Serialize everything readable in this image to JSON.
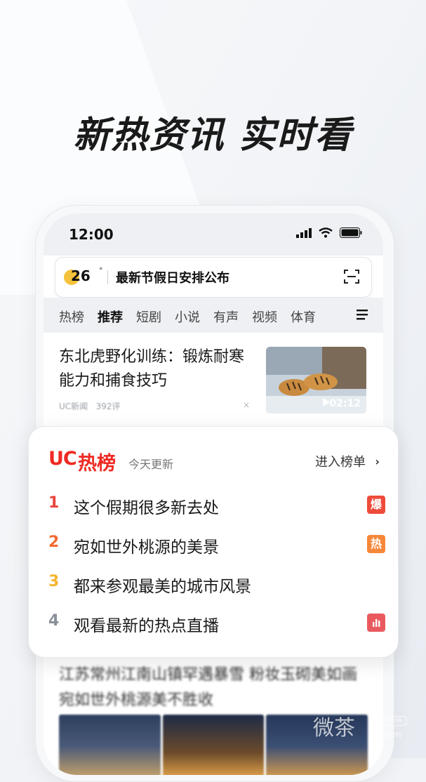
{
  "headline": "新热资讯 实时看",
  "status_bar": {
    "time": "12:00"
  },
  "search": {
    "temperature": "26",
    "degree": "°",
    "hint": "最新节假日安排公布"
  },
  "tabs": [
    "热榜",
    "推荐",
    "短剧",
    "小说",
    "有声",
    "视频",
    "体育"
  ],
  "active_tab": "推荐",
  "news": {
    "title": "东北虎野化训练：锻炼耐寒能力和捕食技巧",
    "source": "UC新闻",
    "comments": "392评",
    "close": "×",
    "duration": "02:12"
  },
  "hot_list": {
    "logo_uc": "UC",
    "logo_cn": "热榜",
    "updated": "今天更新",
    "enter": "进入榜单",
    "chevron": "›",
    "items": [
      {
        "rank": "1",
        "text": "这个假期很多新去处",
        "badge": "爆",
        "rank_color": "#e8453c",
        "badge_color": "#ee4b3a"
      },
      {
        "rank": "2",
        "text": "宛如世外桃源的美景",
        "badge": "热",
        "rank_color": "#f26b32",
        "badge_color": "#f7883a"
      },
      {
        "rank": "3",
        "text": "都来参观最美的城市风景",
        "badge": "",
        "rank_color": "#f5b52e",
        "badge_color": ""
      },
      {
        "rank": "4",
        "text": "观看最新的热点直播",
        "badge": "chart",
        "rank_color": "#8a9099",
        "badge_color": "#e95a5f"
      }
    ]
  },
  "feed_below": {
    "title": "江苏常州江南山镇罕遇暴雪 粉妆玉砌美如画 宛如世外桃源美不胜收"
  },
  "watermark": {
    "text": "微茶",
    "small": "WXCHA",
    "domain": ".com"
  },
  "colors": {
    "accent_red": "#ee2a23"
  }
}
